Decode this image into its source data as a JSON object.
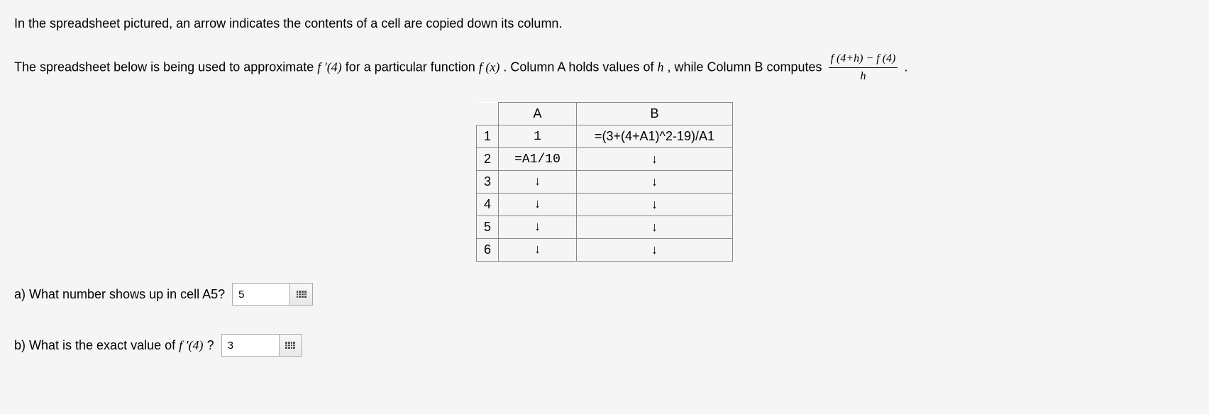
{
  "intro": {
    "p1": "In the spreadsheet pictured, an arrow indicates the contents of a cell are copied down its column.",
    "p2a": "The spreadsheet below is being used to approximate ",
    "p2b": " for a particular function ",
    "p2c": ". Column A holds values of ",
    "p2d": ", while Column B computes ",
    "p2e": " .",
    "fprime4": "f ′(4)",
    "fx": "f (x)",
    "h": "h",
    "frac_num": "f (4+h) − f (4)",
    "frac_den": "h"
  },
  "table": {
    "colA_label": "A",
    "colB_label": "B",
    "rows": [
      {
        "n": "1",
        "a": "1",
        "b": "=(3+(4+A1)^2-19)/A1"
      },
      {
        "n": "2",
        "a": "=A1/10",
        "b": "↓"
      },
      {
        "n": "3",
        "a": "↓",
        "b": "↓"
      },
      {
        "n": "4",
        "a": "↓",
        "b": "↓"
      },
      {
        "n": "5",
        "a": "↓",
        "b": "↓"
      },
      {
        "n": "6",
        "a": "↓",
        "b": "↓"
      }
    ]
  },
  "qA": {
    "label": "a) What number shows up in cell A5?",
    "value": "5"
  },
  "qB": {
    "label_a": "b) What is the exact value of ",
    "label_b": "?",
    "fprime4": "f ′(4)",
    "value": "3"
  }
}
